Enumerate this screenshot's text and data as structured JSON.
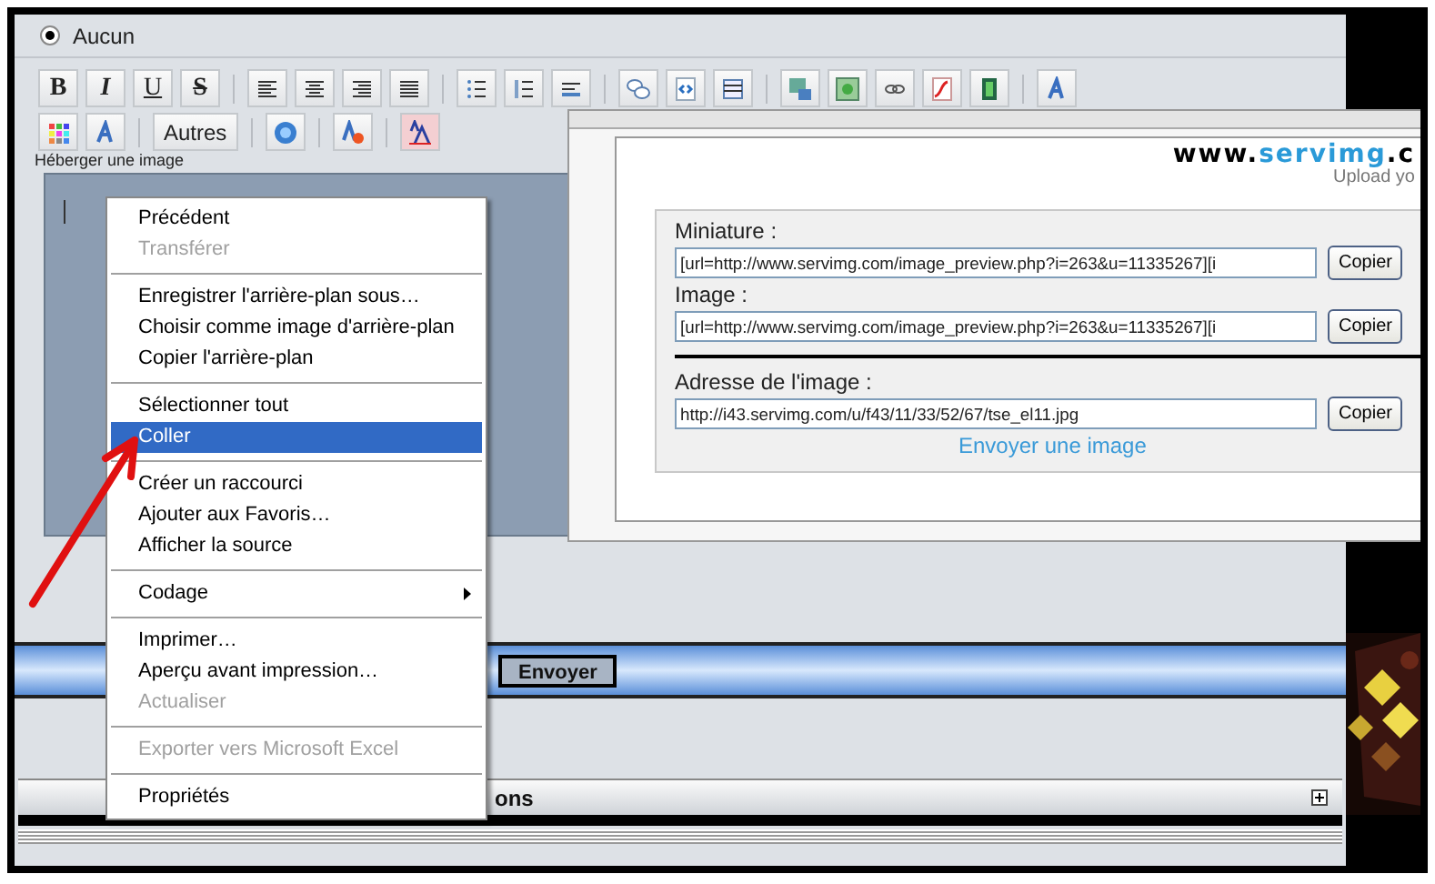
{
  "radio": {
    "label": "Aucun",
    "selected": true
  },
  "toolbar_rows": [
    [
      {
        "kind": "text",
        "label": "B"
      },
      {
        "kind": "text",
        "label": "I"
      },
      {
        "kind": "text",
        "label": "U"
      },
      {
        "kind": "text",
        "label": "S"
      },
      {
        "kind": "separator"
      },
      {
        "kind": "icon"
      },
      {
        "kind": "icon"
      },
      {
        "kind": "icon"
      },
      {
        "kind": "icon"
      },
      {
        "kind": "separator"
      },
      {
        "kind": "icon"
      },
      {
        "kind": "icon"
      },
      {
        "kind": "icon"
      },
      {
        "kind": "separator"
      },
      {
        "kind": "icon"
      },
      {
        "kind": "icon"
      },
      {
        "kind": "icon"
      },
      {
        "kind": "separator"
      },
      {
        "kind": "icon"
      },
      {
        "kind": "icon"
      },
      {
        "kind": "icon"
      },
      {
        "kind": "icon"
      },
      {
        "kind": "icon"
      },
      {
        "kind": "separator"
      },
      {
        "kind": "icon"
      }
    ],
    [
      {
        "kind": "icon"
      },
      {
        "kind": "icon"
      },
      {
        "kind": "separator"
      },
      {
        "kind": "text",
        "label": "Autres"
      },
      {
        "kind": "separator"
      },
      {
        "kind": "icon"
      },
      {
        "kind": "separator"
      },
      {
        "kind": "icon"
      },
      {
        "kind": "separator"
      },
      {
        "kind": "icon"
      }
    ]
  ],
  "upload_label": "Héberger une image",
  "upload_panel": {
    "logo": [
      "www.",
      "servimg",
      ".c"
    ],
    "tagline": "Upload yo",
    "fields": [
      {
        "label": "Miniature :",
        "value": "[url=http://www.servimg.com/image_preview.php?i=263&u=11335267][i",
        "button": "Copier"
      },
      {
        "label": "Image :",
        "value": "[url=http://www.servimg.com/image_preview.php?i=263&u=11335267][i",
        "button": "Copier"
      }
    ],
    "address": {
      "label": "Adresse de l'image :",
      "value": "http://i43.servimg.com/u/f43/11/33/52/67/tse_el11.jpg",
      "button": "Copier"
    },
    "link": "Envoyer une image"
  },
  "submit_button": "Envoyer",
  "section": {
    "title": "ons",
    "expanded": false
  },
  "context_menu": {
    "groups": [
      [
        {
          "label": "Précédent",
          "disabled": false,
          "selected": false,
          "submenu": false
        },
        {
          "label": "Transférer",
          "disabled": true,
          "selected": false,
          "submenu": false
        }
      ],
      [
        {
          "label": "Enregistrer l'arrière-plan sous…",
          "disabled": false,
          "selected": false,
          "submenu": false
        },
        {
          "label": "Choisir comme image d'arrière-plan",
          "disabled": false,
          "selected": false,
          "submenu": false
        },
        {
          "label": "Copier l'arrière-plan",
          "disabled": false,
          "selected": false,
          "submenu": false
        }
      ],
      [
        {
          "label": "Sélectionner tout",
          "disabled": false,
          "selected": false,
          "submenu": false
        },
        {
          "label": "Coller",
          "disabled": false,
          "selected": true,
          "submenu": false
        }
      ],
      [
        {
          "label": "Créer un raccourci",
          "disabled": false,
          "selected": false,
          "submenu": false
        },
        {
          "label": "Ajouter aux Favoris…",
          "disabled": false,
          "selected": false,
          "submenu": false
        },
        {
          "label": "Afficher la source",
          "disabled": false,
          "selected": false,
          "submenu": false
        }
      ],
      [
        {
          "label": "Codage",
          "disabled": false,
          "selected": false,
          "submenu": true
        }
      ],
      [
        {
          "label": "Imprimer…",
          "disabled": false,
          "selected": false,
          "submenu": false
        },
        {
          "label": "Aperçu avant impression…",
          "disabled": false,
          "selected": false,
          "submenu": false
        },
        {
          "label": "Actualiser",
          "disabled": true,
          "selected": false,
          "submenu": false
        }
      ],
      [
        {
          "label": "Exporter vers Microsoft Excel",
          "disabled": true,
          "selected": false,
          "submenu": false
        }
      ],
      [
        {
          "label": "Propriétés",
          "disabled": false,
          "selected": false,
          "submenu": false
        }
      ]
    ]
  }
}
